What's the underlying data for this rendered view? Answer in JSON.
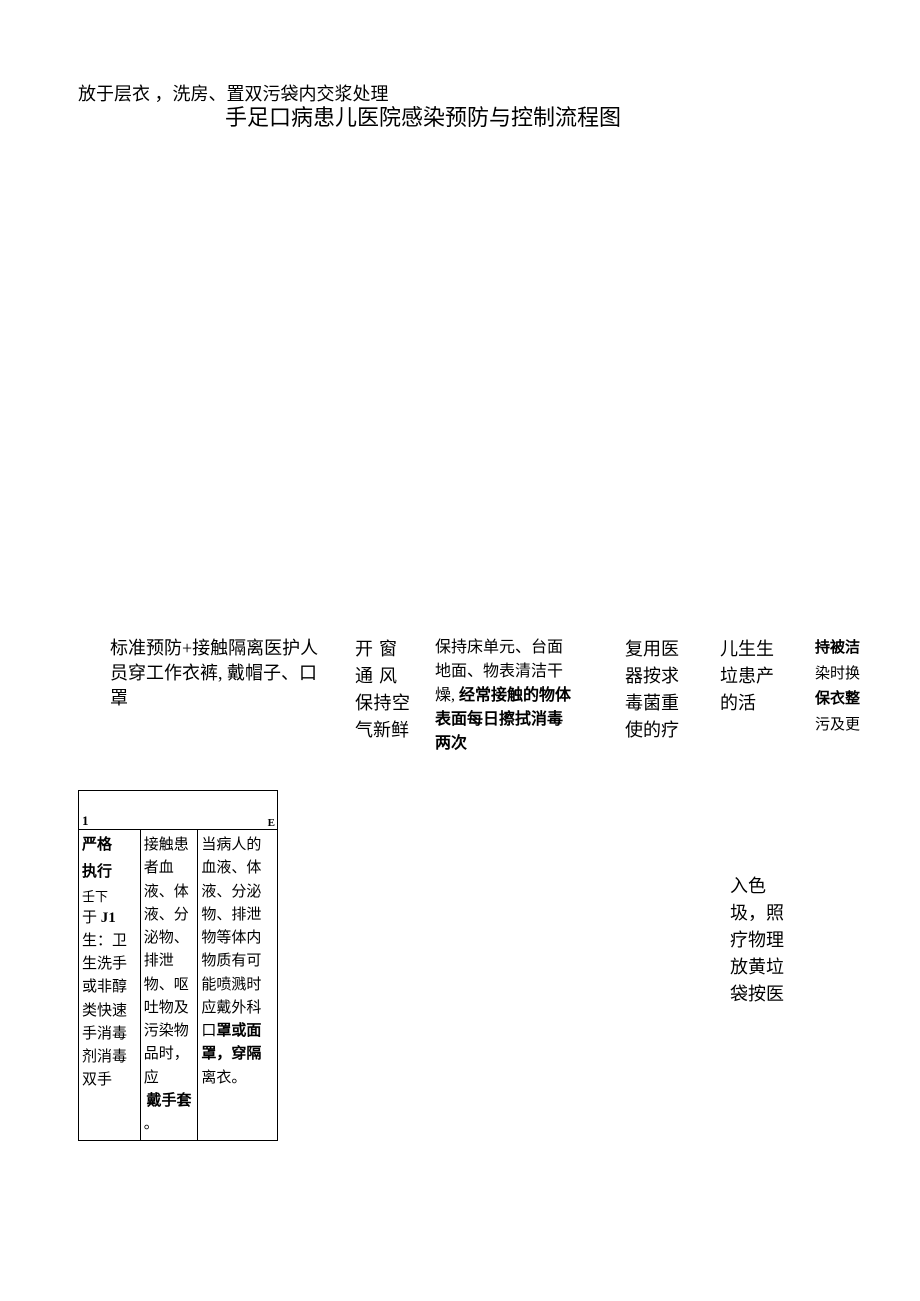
{
  "top_note": "放于层衣 ，洗房、置双污袋内交浆处理",
  "title": "手足口病患儿医院感染预防与控制流程图",
  "columns": {
    "col1": "标准预防+接触隔离医护人员穿工作衣裤, 戴帽子、口罩",
    "col2_line1": "开窗",
    "col2_line2": "通风",
    "col2_rest": "保持空气新鲜",
    "col3_plain": "保持床单元、台面地面、物表清洁干燥,",
    "col3_bold": "经常接触的物体表面每日擦拭消毒两次",
    "col4": "复用医器按求毒菌重使的疗",
    "col5": "儿生生垃患产的活",
    "col6_bold1": "持被洁",
    "col6_plain1": "染时换",
    "col6_bold2": "保衣整",
    "col6_plain2": "污及更"
  },
  "table_header": {
    "num": "1",
    "right": "E"
  },
  "table": {
    "c1_bold1": "严格",
    "c1_bold2": "执行",
    "c1_rest": "壬下于 J1 生：卫生洗手或非醇类快速手消毒剂消毒双手",
    "c2_main": "接触患者血液、体液、分泌物、排泄物、呕吐物及污染物品时，应",
    "c2_bold": "戴手套",
    "c2_end": "。",
    "c3_pre": "当病人的血液、体液、分泌物、排泄物等体内物质有可能喷溅时应戴外科口",
    "c3_bold": "罩或面罩，穿隔",
    "c3_post": "离衣。"
  },
  "trail": "入色圾，照疗物理放黄垃袋按医"
}
